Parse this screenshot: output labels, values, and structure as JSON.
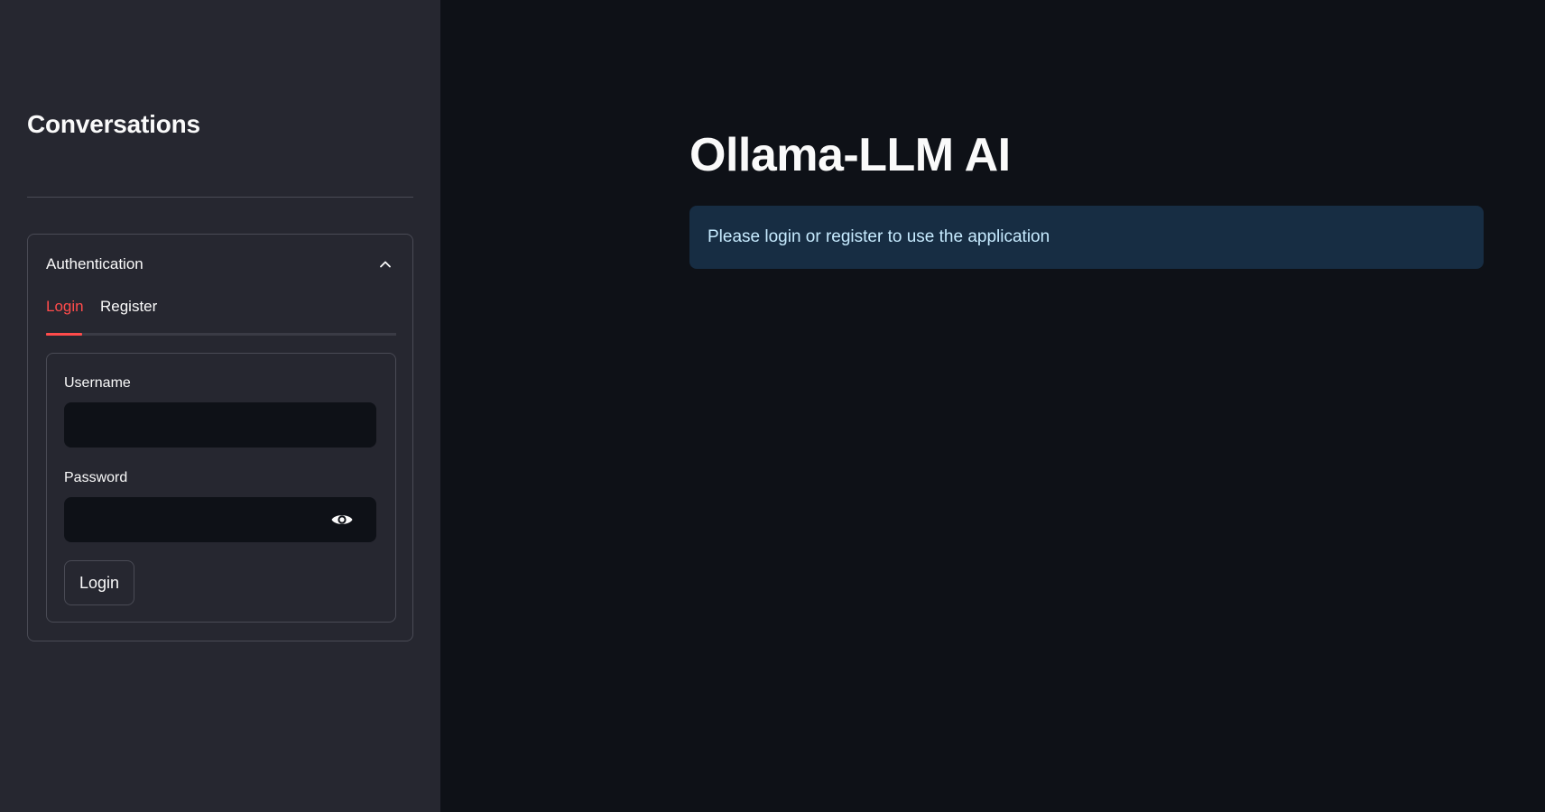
{
  "sidebar": {
    "title": "Conversations",
    "expander": {
      "title": "Authentication",
      "expanded": true,
      "tabs": [
        {
          "label": "Login",
          "active": true
        },
        {
          "label": "Register",
          "active": false
        }
      ],
      "form": {
        "username_label": "Username",
        "username_value": "",
        "password_label": "Password",
        "password_value": "",
        "submit_label": "Login"
      }
    }
  },
  "main": {
    "title": "Ollama-LLM AI",
    "info_message": "Please login or register to use the application"
  },
  "icons": {
    "expander_toggle": "chevron-up-icon",
    "password_visibility": "eye-icon"
  },
  "colors": {
    "accent": "#ff4b4b",
    "background": "#0e1117",
    "sidebar": "#262730",
    "info_background": "#172d43",
    "info_text": "#c7ebff"
  }
}
